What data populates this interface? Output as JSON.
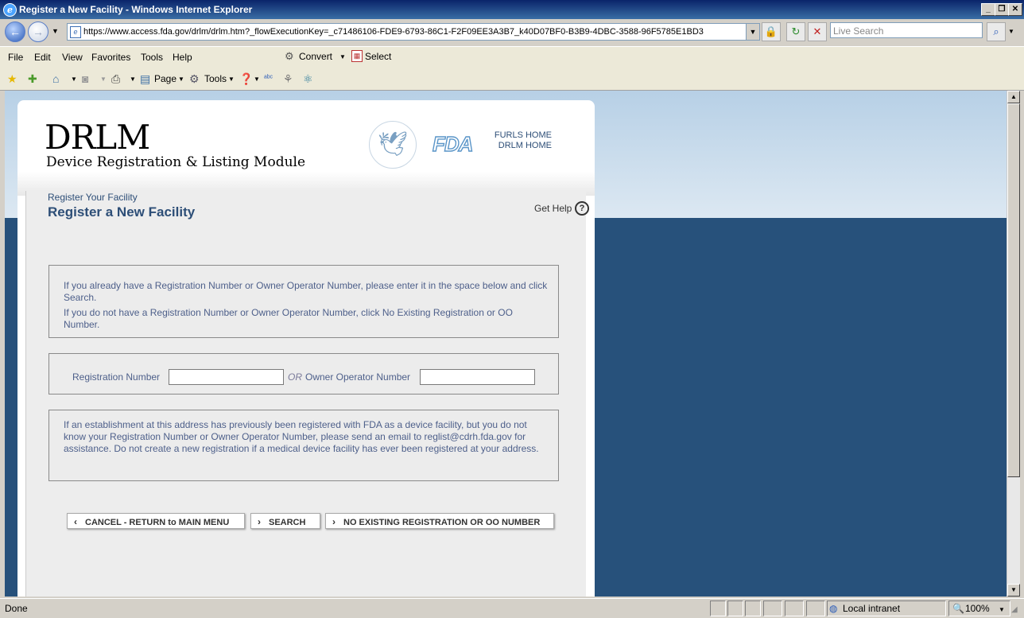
{
  "window": {
    "title": "Register a New Facility - Windows Internet Explorer"
  },
  "address": {
    "url": "https://www.access.fda.gov/drlm/drlm.htm?_flowExecutionKey=_c71486106-FDE9-6793-86C1-F2F09EE3A3B7_k40D07BF0-B3B9-4DBC-3588-96F5785E1BD3",
    "search_placeholder": "Live Search"
  },
  "menu": {
    "items": [
      "File",
      "Edit",
      "View",
      "Favorites",
      "Tools",
      "Help"
    ],
    "convert": "Convert",
    "select": "Select"
  },
  "toolbar": {
    "page": "Page",
    "tools": "Tools"
  },
  "site": {
    "logo": "DRLM",
    "logo_sub": "Device Registration & Listing Module",
    "fda": "FDA",
    "links": [
      "FURLS HOME",
      "DRLM HOME"
    ]
  },
  "page": {
    "breadcrumb": "Register Your Facility",
    "title": "Register a New Facility",
    "get_help": "Get Help",
    "instructions": [
      "If you already have a Registration Number or Owner Operator Number, please enter it in the space below and click Search.",
      "If you do not have a Registration Number or Owner Operator Number, click No Existing Registration or OO Number."
    ],
    "reg_label": "Registration Number",
    "or_label": "OR",
    "oo_label": "Owner Operator Number",
    "note": "If an establishment at this address has previously been registered with FDA as a device facility, but you do not know your Registration Number or Owner Operator Number, please send an email to reglist@cdrh.fda.gov for assistance. Do not create a new registration if a medical device facility has ever been registered at your address.",
    "buttons": {
      "cancel": "CANCEL - RETURN to MAIN MENU",
      "search": "SEARCH",
      "no_existing": "NO EXISTING REGISTRATION OR OO NUMBER"
    }
  },
  "status": {
    "left": "Done",
    "zone": "Local intranet",
    "zoom": "100%"
  }
}
